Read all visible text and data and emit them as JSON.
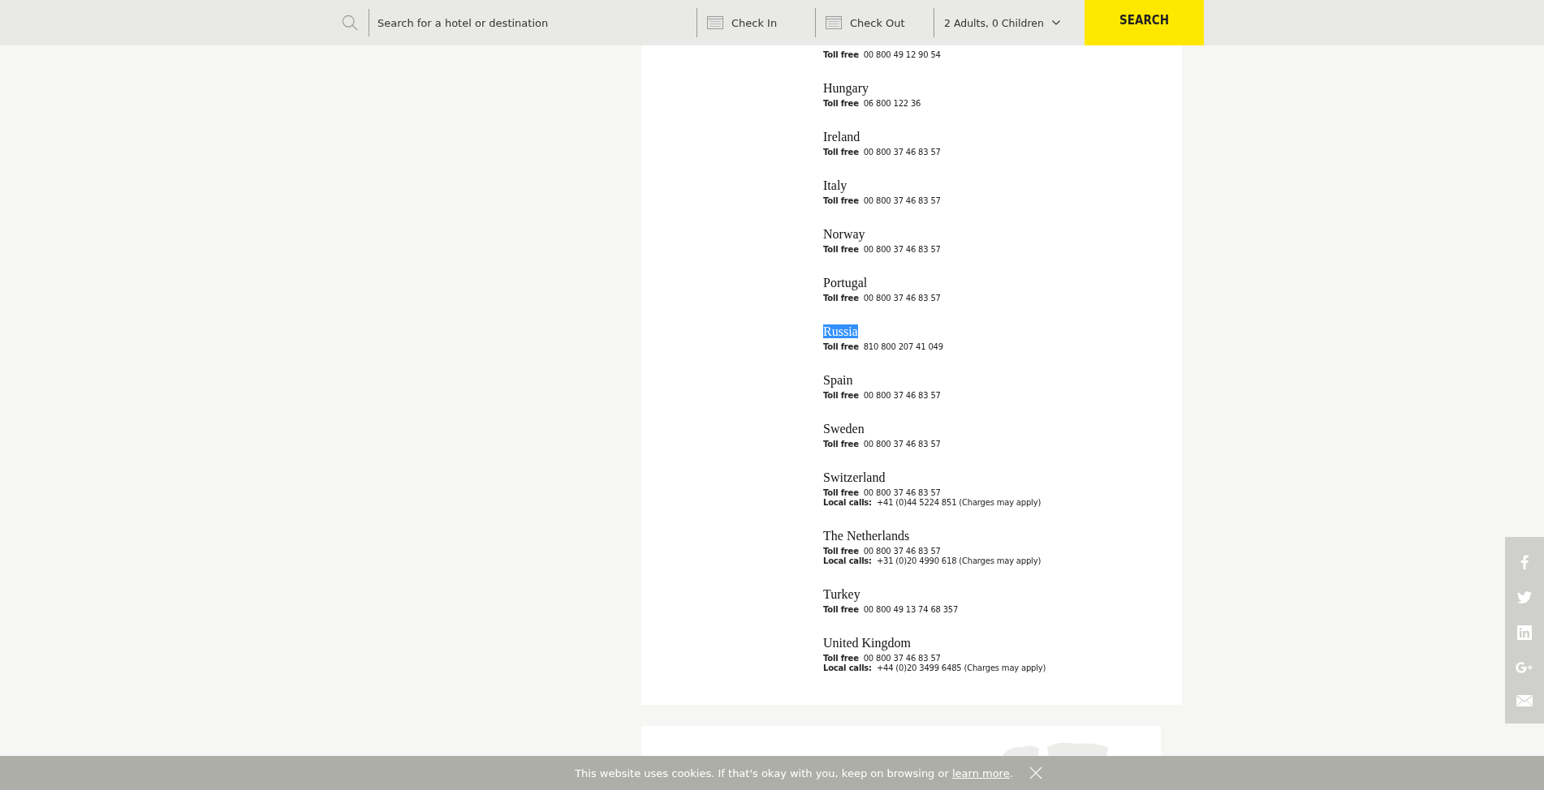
{
  "header": {
    "search_placeholder": "Search for a hotel or destination",
    "check_in": "Check In",
    "check_out": "Check Out",
    "guests": "2 Adults, 0 Children",
    "search_button": "SEARCH"
  },
  "countries": [
    {
      "selected": false,
      "lines": [
        {
          "label": "Toll free",
          "value": "00 800 49 12 90 54"
        }
      ]
    },
    {
      "name": "Hungary",
      "selected": false,
      "lines": [
        {
          "label": "Toll free",
          "value": "06 800 122 36"
        }
      ]
    },
    {
      "name": "Ireland",
      "selected": false,
      "lines": [
        {
          "label": "Toll free",
          "value": "00 800 37 46 83 57"
        }
      ]
    },
    {
      "name": "Italy",
      "selected": false,
      "lines": [
        {
          "label": "Toll free",
          "value": "00 800 37 46 83 57"
        }
      ]
    },
    {
      "name": "Norway",
      "selected": false,
      "lines": [
        {
          "label": "Toll free",
          "value": "00 800 37 46 83 57"
        }
      ]
    },
    {
      "name": "Portugal",
      "selected": false,
      "lines": [
        {
          "label": "Toll free",
          "value": "00 800 37 46 83 57"
        }
      ]
    },
    {
      "name": "Russia",
      "selected": true,
      "lines": [
        {
          "label": "Toll free",
          "value": "810 800 207 41 049"
        }
      ]
    },
    {
      "name": "Spain",
      "selected": false,
      "lines": [
        {
          "label": "Toll free",
          "value": "00 800 37 46 83 57"
        }
      ]
    },
    {
      "name": "Sweden",
      "selected": false,
      "lines": [
        {
          "label": "Toll free",
          "value": "00 800 37 46 83 57"
        }
      ]
    },
    {
      "name": "Switzerland",
      "selected": false,
      "lines": [
        {
          "label": "Toll free",
          "value": "00 800 37 46 83 57"
        },
        {
          "label": "Local calls:",
          "value": "+41 (0)44 5224 851 (Charges may apply)"
        }
      ]
    },
    {
      "name": "The Netherlands",
      "selected": false,
      "lines": [
        {
          "label": "Toll free",
          "value": "00 800 37 46 83 57"
        },
        {
          "label": "Local calls:",
          "value": "+31 (0)20 4990 618 (Charges may apply)"
        }
      ]
    },
    {
      "name": "Turkey",
      "selected": false,
      "lines": [
        {
          "label": "Toll free",
          "value": "00 800 49 13 74 68 357"
        }
      ]
    },
    {
      "name": "United Kingdom",
      "selected": false,
      "lines": [
        {
          "label": "Toll free",
          "value": "00 800 37 46 83 57"
        },
        {
          "label": "Local calls:",
          "value": "+44 (0)20 3499 6485 (Charges may apply)"
        }
      ]
    }
  ],
  "cookie_bar": {
    "text": "This website uses cookies. If that's okay with you, keep on browsing or ",
    "link": "learn more",
    "suffix": "."
  }
}
